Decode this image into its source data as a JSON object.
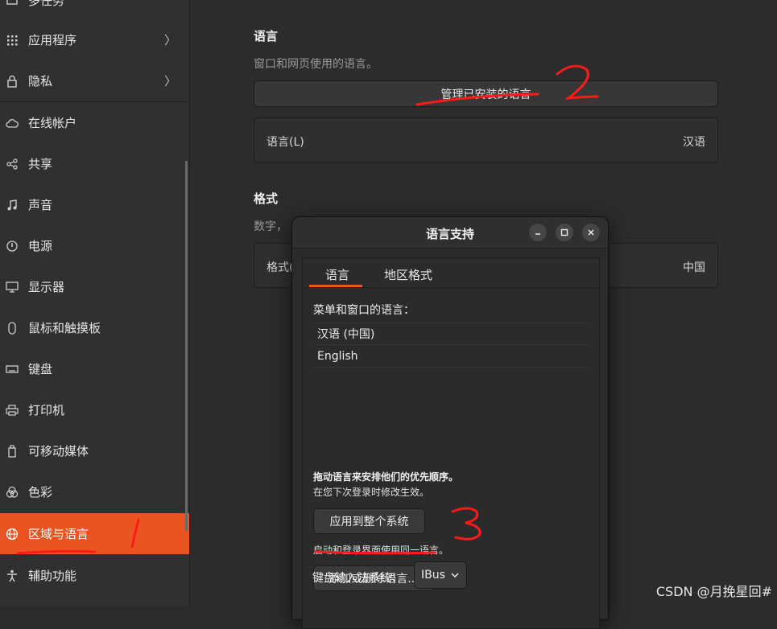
{
  "sidebar": {
    "items": [
      {
        "label": "多任务",
        "icon": "multitasking-icon",
        "chevron": ""
      },
      {
        "label": "应用程序",
        "icon": "apps-grid-icon",
        "chevron": "〉"
      },
      {
        "label": "隐私",
        "icon": "lock-icon",
        "chevron": "〉"
      },
      {
        "label": "在线帐户",
        "icon": "cloud-icon",
        "chevron": ""
      },
      {
        "label": "共享",
        "icon": "share-icon",
        "chevron": ""
      },
      {
        "label": "声音",
        "icon": "music-note-icon",
        "chevron": ""
      },
      {
        "label": "电源",
        "icon": "power-icon",
        "chevron": ""
      },
      {
        "label": "显示器",
        "icon": "display-icon",
        "chevron": ""
      },
      {
        "label": "鼠标和触摸板",
        "icon": "mouse-icon",
        "chevron": ""
      },
      {
        "label": "键盘",
        "icon": "keyboard-icon",
        "chevron": ""
      },
      {
        "label": "打印机",
        "icon": "printer-icon",
        "chevron": ""
      },
      {
        "label": "可移动媒体",
        "icon": "removable-media-icon",
        "chevron": ""
      },
      {
        "label": "色彩",
        "icon": "color-icon",
        "chevron": ""
      },
      {
        "label": "区域与语言",
        "icon": "globe-icon",
        "chevron": "",
        "active": true
      },
      {
        "label": "辅助功能",
        "icon": "accessibility-icon",
        "chevron": ""
      }
    ]
  },
  "main": {
    "language_section": {
      "title": "语言",
      "description": "窗口和网页使用的语言。",
      "manage_button": "管理已安装的语言",
      "row_label": "语言(L)",
      "row_value": "汉语"
    },
    "format_section": {
      "title": "格式",
      "description": "数字，",
      "row_label": "格式(",
      "row_value": "中国"
    }
  },
  "dialog": {
    "title": "语言支持",
    "tabs": [
      "语言",
      "地区格式"
    ],
    "menu_label": "菜单和窗口的语言：",
    "languages": [
      "汉语 (中国)",
      "English"
    ],
    "drag_hint": "拖动语言来安排他们的优先顺序。",
    "next_login_hint": "在您下次登录时修改生效。",
    "apply_button": "应用到整个系统",
    "apply_hint": "启动和登录界面使用同一语言。",
    "add_remove_button": "添加或删除语言...",
    "keyboard_label": "键盘输入法系统：",
    "keyboard_value": "IBus"
  },
  "annotations": [
    "1",
    "2",
    "3"
  ],
  "watermark": "CSDN @月挽星回#",
  "colors": {
    "accent": "#e95420",
    "annotation": "#ff1a1a"
  }
}
